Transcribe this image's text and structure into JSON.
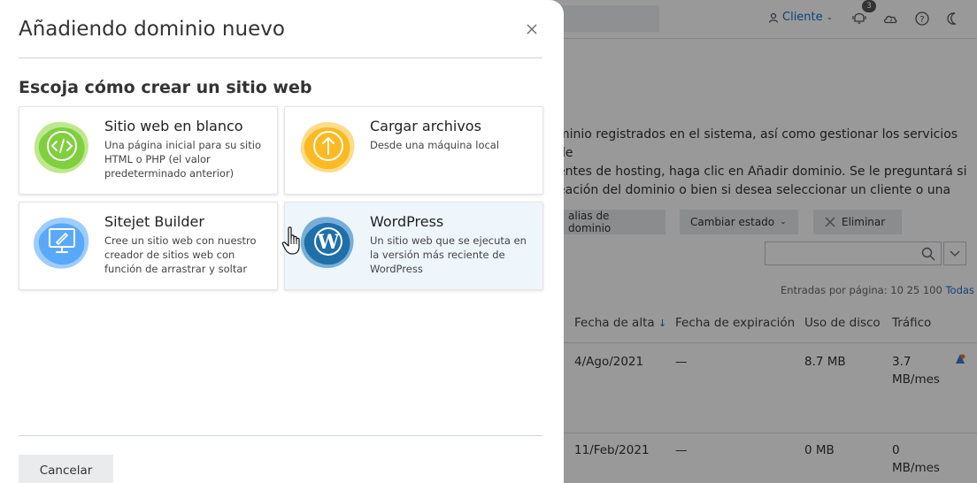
{
  "background": {
    "header": {
      "client_label": "Cliente",
      "notification_count": "3"
    },
    "description": "...minio registrados en el sistema, así como gestionar los servicios de ...entes de hosting, haga clic en Añadir dominio. Se le preguntará si ...eación del dominio o bien si desea seleccionar un cliente o una",
    "description_lines": [
      "minio registrados en el sistema, así como gestionar los servicios de",
      "entes de hosting, haga clic en Añadir dominio. Se le preguntará si",
      "eación del dominio o bien si desea seleccionar un cliente o una"
    ],
    "toolbar": {
      "alias_label": "alias de dominio",
      "change_status_label": "Cambiar estado",
      "delete_label": "Eliminar"
    },
    "per_page": {
      "label": "Entradas por página:",
      "options": [
        "10",
        "25",
        "100",
        "Todas"
      ]
    },
    "table": {
      "columns": [
        "Fecha de alta",
        "Fecha de expiración",
        "Uso de disco",
        "Tráfico"
      ],
      "rows": [
        {
          "created": "4/Ago/2021",
          "expires": "—",
          "disk": "8.7 MB",
          "traffic_value": "3.7",
          "traffic_unit": "MB/mes"
        },
        {
          "created": "11/Feb/2021",
          "expires": "—",
          "disk": "0 MB",
          "traffic_value": "0",
          "traffic_unit": "MB/mes"
        }
      ]
    }
  },
  "modal": {
    "title": "Añadiendo dominio nuevo",
    "close_icon": "close-icon",
    "section_title": "Escoja cómo crear un sitio web",
    "options": [
      {
        "title": "Sitio web en blanco",
        "description": "Una página inicial para su sitio HTML o PHP (el valor predeterminado anterior)",
        "icon": "code-icon",
        "color": "#8bd641"
      },
      {
        "title": "Cargar archivos",
        "description": "Desde una máquina local",
        "icon": "upload-icon",
        "color": "#fbbd2a"
      },
      {
        "title": "Sitejet Builder",
        "description": "Cree un sitio web con nuestro creador de sitios web con función de arrastrar y soltar",
        "icon": "builder-icon",
        "color": "#5aa9f8"
      },
      {
        "title": "WordPress",
        "description": "Un sitio web que se ejecuta en la versión más reciente de WordPress",
        "icon": "wordpress-icon",
        "color": "#1f6fa8"
      }
    ],
    "cancel_label": "Cancelar"
  },
  "colors": {
    "link": "#1a6ec8",
    "hover_card": "#eef6fc",
    "overlay": "rgba(0,0,0,0.40)"
  }
}
